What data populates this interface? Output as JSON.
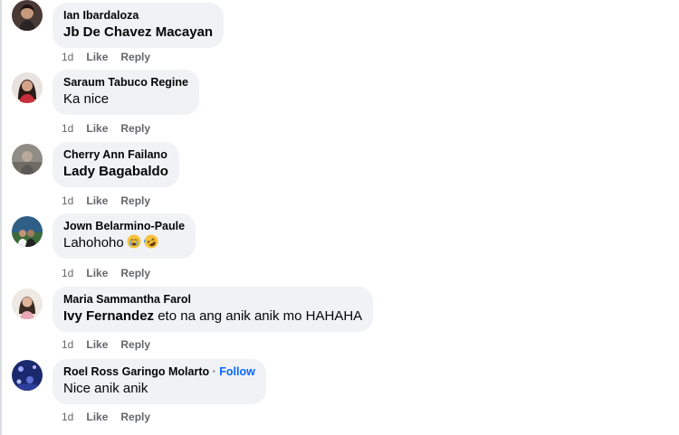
{
  "comments": [
    {
      "author": "Ian Ibardaloza",
      "tag": "Jb De Chavez Macayan",
      "text": "",
      "time": "1d",
      "like": "Like",
      "reply": "Reply"
    },
    {
      "author": "Saraum Tabuco Regine",
      "tag": "",
      "text": "Ka nice",
      "time": "1d",
      "like": "Like",
      "reply": "Reply"
    },
    {
      "author": "Cherry Ann Failano",
      "tag": "Lady Bagabaldo",
      "text": "",
      "time": "1d",
      "like": "Like",
      "reply": "Reply"
    },
    {
      "author": "Jown Belarmino-Paule",
      "tag": "",
      "text": "Lahohoho",
      "emojis": [
        "crying-face-emoji",
        "rolling-laughing-emoji"
      ],
      "time": "1d",
      "like": "Like",
      "reply": "Reply"
    },
    {
      "author": "Maria Sammantha Farol",
      "tag": "Ivy Fernandez",
      "text": " eto na ang anik anik mo HAHAHA",
      "time": "1d",
      "like": "Like",
      "reply": "Reply"
    },
    {
      "author": "Roel Ross Garingo Molarto",
      "separator": " · ",
      "follow": "Follow",
      "tag": "",
      "text": "Nice anik anik",
      "time": "1d",
      "like": "Like",
      "reply": "Reply"
    }
  ],
  "colors": {
    "bubble": "#f0f2f5",
    "secondary_text": "#65676b",
    "follow_link": "#0866ff"
  }
}
